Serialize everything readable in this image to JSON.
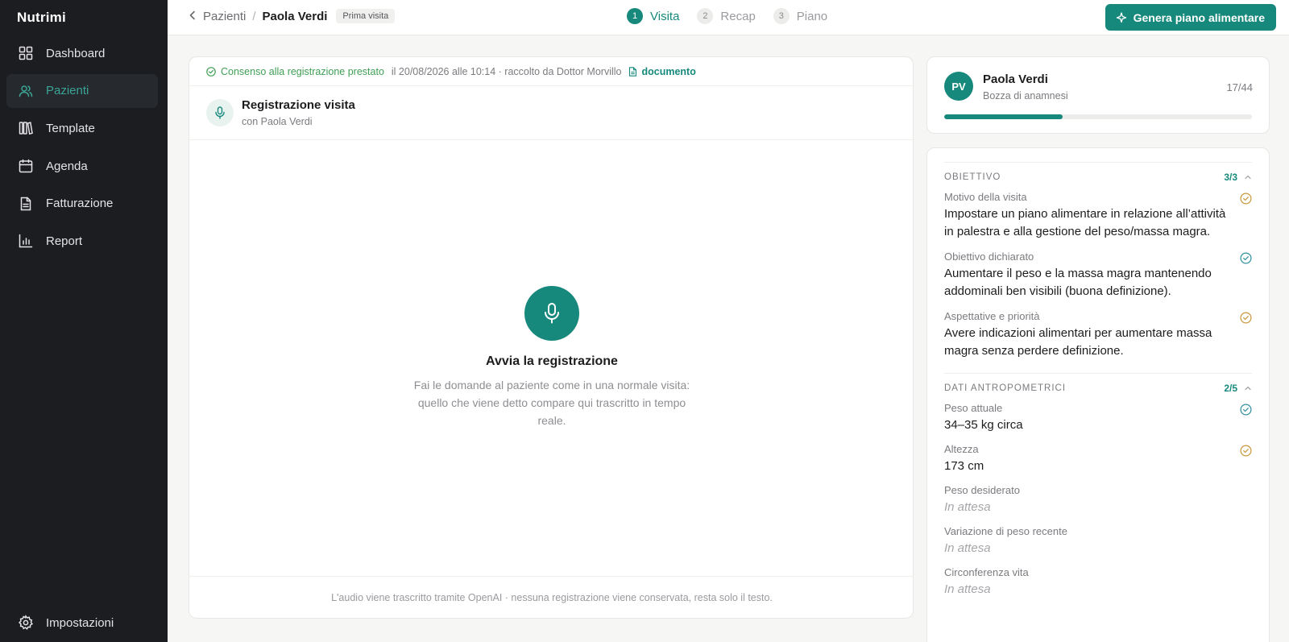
{
  "sidebar": {
    "brand": "Nutrimi",
    "items": [
      {
        "label": "Dashboard",
        "icon": "dashboard-icon",
        "active": false
      },
      {
        "label": "Pazienti",
        "icon": "users-icon",
        "active": true
      },
      {
        "label": "Template",
        "icon": "library-icon",
        "active": false
      },
      {
        "label": "Agenda",
        "icon": "calendar-icon",
        "active": false
      },
      {
        "label": "Fatturazione",
        "icon": "invoice-icon",
        "active": false
      },
      {
        "label": "Report",
        "icon": "chart-icon",
        "active": false
      }
    ],
    "settings_label": "Impostazioni"
  },
  "topbar": {
    "back_icon": "chevron-left-icon",
    "crumb_parent": "Pazienti",
    "crumb_separator": "/",
    "crumb_current": "Paola Verdi",
    "badge": "Prima visita",
    "steps": [
      {
        "num": "1",
        "label": "Visita",
        "active": true
      },
      {
        "num": "2",
        "label": "Recap",
        "active": false
      },
      {
        "num": "3",
        "label": "Piano",
        "active": false
      }
    ],
    "generate_label": "Genera piano alimentare"
  },
  "consent": {
    "text": "Consenso alla registrazione prestato",
    "meta": "il 20/08/2026 alle 10:14 · raccolto da Dottor Morvillo",
    "doc_link": "documento"
  },
  "recording": {
    "title": "Registrazione visita",
    "subtitle": "con Paola Verdi",
    "start_title": "Avvia la registrazione",
    "start_desc": "Fai le domande al paziente come in una normale visita: quello che viene detto compare qui trascritto in tempo reale.",
    "footer": "L'audio viene trascritto tramite OpenAI · nessuna registrazione viene conservata, resta solo il testo."
  },
  "patient": {
    "initials": "PV",
    "name": "Paola Verdi",
    "status": "Bozza di anamnesi",
    "count": "17/44",
    "progress_fraction": 0.386
  },
  "anamnesis": {
    "sections": [
      {
        "title": "OBIETTIVO",
        "count": "3/3",
        "fields": [
          {
            "label": "Motivo della visita",
            "value": "Impostare un piano alimentare in relazione all’attività in palestra e alla gestione del peso/massa magra.",
            "status": "orange"
          },
          {
            "label": "Obiettivo dichiarato",
            "value": "Aumentare il peso e la massa magra mantenendo addominali ben visibili (buona definizione).",
            "status": "teal"
          },
          {
            "label": "Aspettative e priorità",
            "value": "Avere indicazioni alimentari per aumentare massa magra senza perdere definizione.",
            "status": "orange"
          }
        ]
      },
      {
        "title": "DATI ANTROPOMETRICI",
        "count": "2/5",
        "fields": [
          {
            "label": "Peso attuale",
            "value": "34–35 kg circa",
            "status": "teal"
          },
          {
            "label": "Altezza",
            "value": "173 cm",
            "status": "orange"
          },
          {
            "label": "Peso desiderato",
            "value": "In attesa",
            "status": "pending"
          },
          {
            "label": "Variazione di peso recente",
            "value": "In attesa",
            "status": "pending"
          },
          {
            "label": "Circonferenza vita",
            "value": "In attesa",
            "status": "pending"
          }
        ]
      }
    ]
  },
  "colors": {
    "accent": "#16897c",
    "sidebar_bg": "#1c1d21",
    "consent_green": "#3f9f54",
    "check_teal": "#2f8f9e",
    "check_orange": "#c9973a"
  }
}
